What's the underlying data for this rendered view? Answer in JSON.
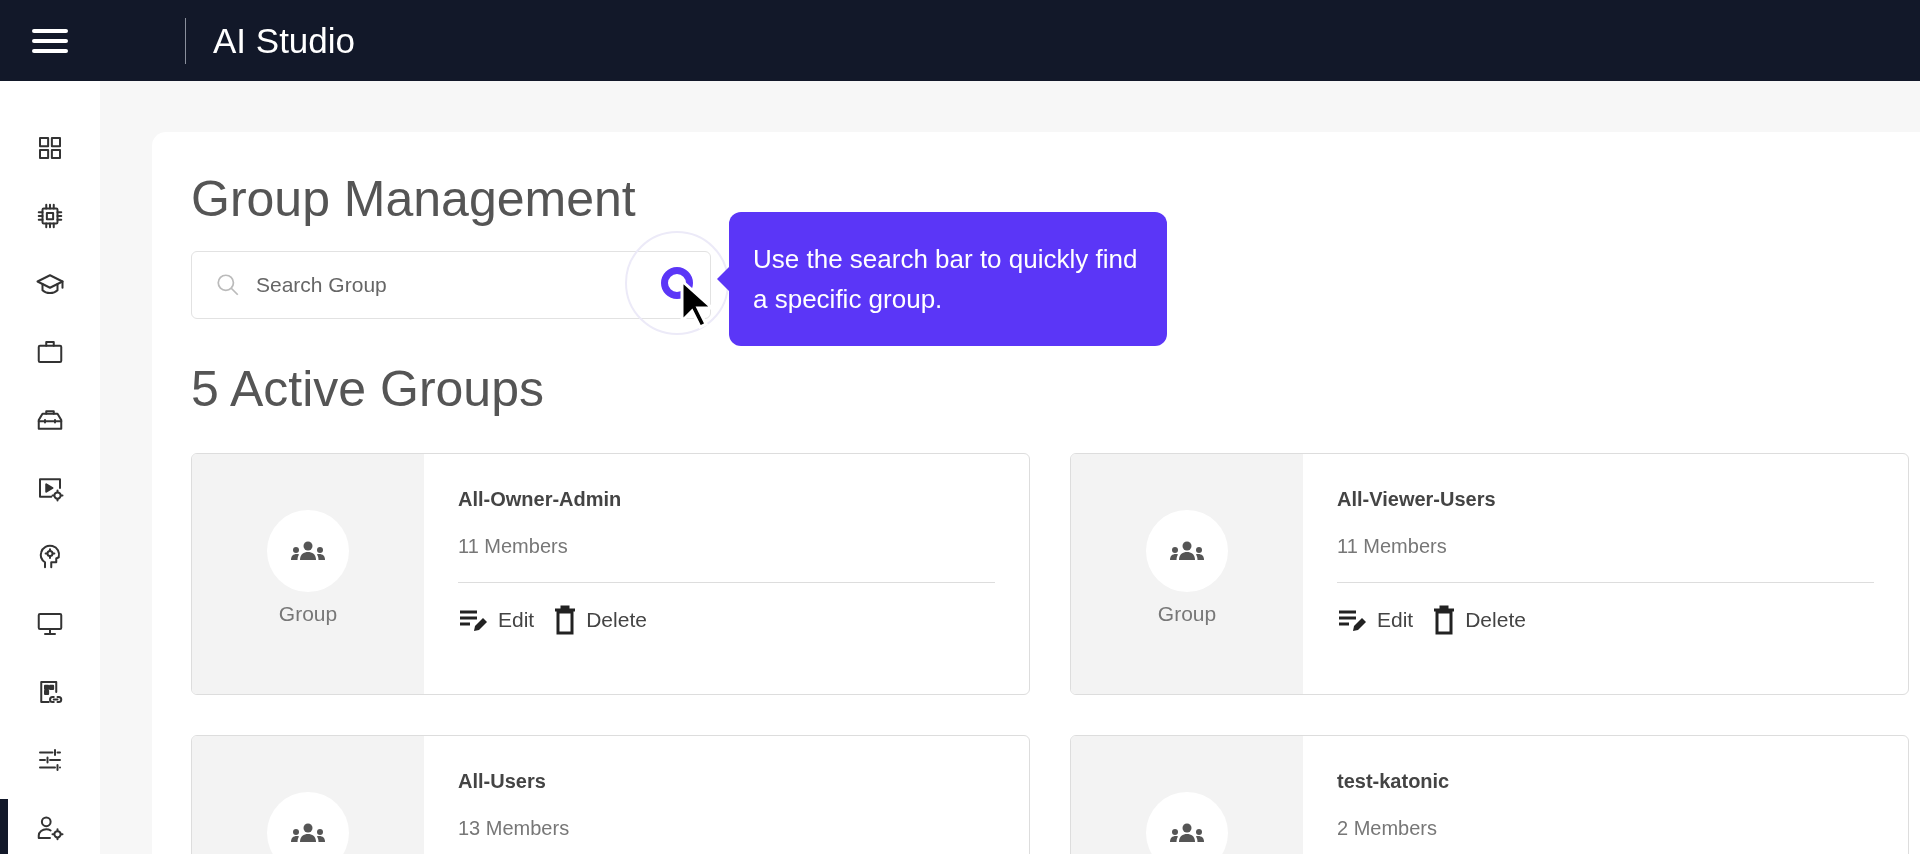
{
  "header": {
    "title": "AI Studio"
  },
  "sidebar": {
    "items": [
      {
        "kind": "grid",
        "selected": false
      },
      {
        "kind": "chip",
        "selected": false
      },
      {
        "kind": "cap",
        "selected": false
      },
      {
        "kind": "briefcase",
        "selected": false
      },
      {
        "kind": "toolbox",
        "selected": false
      },
      {
        "kind": "video",
        "selected": false
      },
      {
        "kind": "head",
        "selected": false
      },
      {
        "kind": "monitor",
        "selected": false
      },
      {
        "kind": "doclink",
        "selected": false
      },
      {
        "kind": "sliders",
        "selected": false
      },
      {
        "kind": "usergear",
        "selected": true
      }
    ]
  },
  "page": {
    "title": "Group Management",
    "search": {
      "placeholder": "Search Group"
    },
    "tooltip": {
      "text": "Use the search bar to quickly find a specific group."
    },
    "subtitle": "5 Active Groups",
    "groups": [
      {
        "name": "All-Owner-Admin",
        "members": "11 Members",
        "avatar_label": "Group",
        "actions": [
          "Edit",
          "Delete"
        ]
      },
      {
        "name": "All-Viewer-Users",
        "members": "11 Members",
        "avatar_label": "Group",
        "actions": [
          "Edit",
          "Delete"
        ]
      },
      {
        "name": "All-Users",
        "members": "13 Members"
      },
      {
        "name": "test-katonic",
        "members": "2 Members"
      }
    ]
  }
}
